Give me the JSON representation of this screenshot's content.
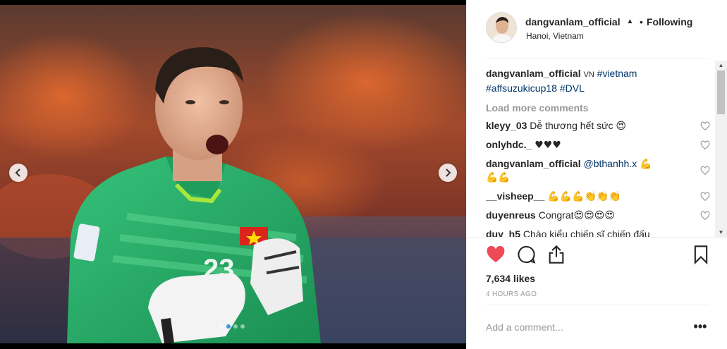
{
  "post": {
    "username": "dangvanlam_official",
    "follow_separator": "•",
    "follow_label": "Following",
    "location": "Hanoi, Vietnam",
    "likes": "7,634 likes",
    "time": "4 HOURS AGO"
  },
  "caption": {
    "username": "dangvanlam_official",
    "text": "VN",
    "tags": [
      "#vietnam",
      "#affsuzukicup18",
      "#DVL"
    ]
  },
  "load_more": "Load more comments",
  "comments": [
    {
      "user": "kleyy_03",
      "text": "Dễ thương hết sức",
      "emoji": "😍"
    },
    {
      "user": "onlyhdc._",
      "text": "",
      "emoji": "♥♥♥"
    },
    {
      "user": "dangvanlam_official",
      "text": "",
      "mention": "@bthanhh.x",
      "emoji": "💪",
      "emoji2": "💪💪"
    },
    {
      "user": "__visheep__",
      "text": "",
      "emoji": "💪💪💪👏👏👏"
    },
    {
      "user": "duyenreus",
      "text": "Congrat",
      "emoji": "😍😍😍😍"
    },
    {
      "user": "duy_h5",
      "text": "Chào kiểu chiến sĩ chiến đấu",
      "emoji": ""
    }
  ],
  "add_comment": {
    "placeholder": "Add a comment..."
  },
  "more_label": "•••",
  "carousel": {
    "slides": 4,
    "active": 1
  },
  "icons": {
    "prev": "chevron-left-icon",
    "next": "chevron-right-icon",
    "like": "heart-filled-icon",
    "comment": "comment-bubble-icon",
    "share": "share-icon",
    "save": "bookmark-icon",
    "verified": "verified-icon"
  },
  "colors": {
    "like": "#ed4956",
    "tag": "#003569",
    "muted": "#999999",
    "dot_active": "#3897f0"
  }
}
